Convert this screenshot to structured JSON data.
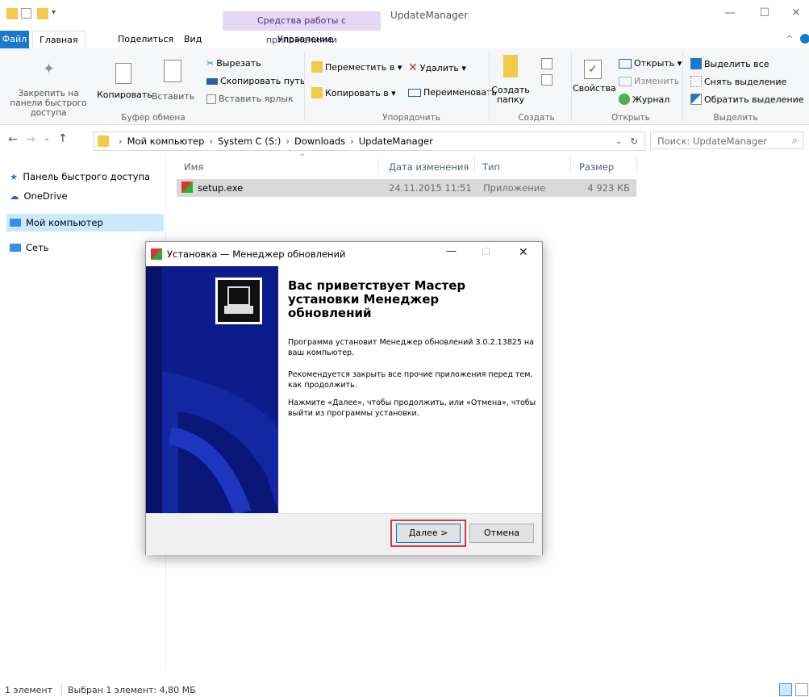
{
  "window": {
    "context_tab": "Средства работы с приложениями",
    "title": "UpdateManager"
  },
  "ribbon_tabs": [
    "Файл",
    "Главная",
    "Поделиться",
    "Вид",
    "Управление"
  ],
  "ribbon": {
    "pin": "Закрепить на панели быстрого доступа",
    "copy": "Копировать",
    "paste": "Вставить",
    "cut": "Вырезать",
    "copy_path": "Скопировать путь",
    "paste_shortcut": "Вставить ярлык",
    "group_clipboard": "Буфер обмена",
    "move_to": "Переместить в ▾",
    "copy_to": "Копировать в ▾",
    "delete": "Удалить ▾",
    "rename": "Переименовать",
    "group_organize": "Упорядочить",
    "new_folder": "Создать папку",
    "group_new": "Создать",
    "properties": "Свойства",
    "open": "Открыть ▾",
    "edit": "Изменить",
    "history": "Журнал",
    "group_open": "Открыть",
    "select_all": "Выделить все",
    "select_none": "Снять выделение",
    "invert_selection": "Обратить выделение",
    "group_select": "Выделить"
  },
  "address": {
    "crumbs": [
      "Мой компьютер",
      "System C (S:)",
      "Downloads",
      "UpdateManager"
    ],
    "search_placeholder": "Поиск: UpdateManager"
  },
  "nav": {
    "quick_access": "Панель быстрого доступа",
    "onedrive": "OneDrive",
    "this_pc": "Мой компьютер",
    "network": "Сеть"
  },
  "columns": {
    "name": "Имя",
    "date": "Дата изменения",
    "type": "Тип",
    "size": "Размер"
  },
  "file": {
    "name": "setup.exe",
    "date": "24.11.2015 11:51",
    "type": "Приложение",
    "size": "4 923 КБ"
  },
  "status": {
    "count": "1 элемент",
    "selected": "Выбран 1 элемент: 4,80 МБ"
  },
  "dialog": {
    "title": "Установка — Менеджер обновлений",
    "heading": "Вас приветствует Мастер установки Менеджер обновлений",
    "p1": "Программа установит Менеджер обновлений 3.0.2.13825 на ваш компьютер.",
    "p2": "Рекомендуется закрыть все прочие приложения перед тем, как продолжить.",
    "p3": "Нажмите «Далее», чтобы продолжить, или «Отмена», чтобы выйти из программы установки.",
    "next": "Далее >",
    "cancel": "Отмена"
  },
  "colors": {
    "accent": "#1979ca",
    "wizard_blue": "#0c1c8c",
    "highlight": "#d9393b"
  }
}
